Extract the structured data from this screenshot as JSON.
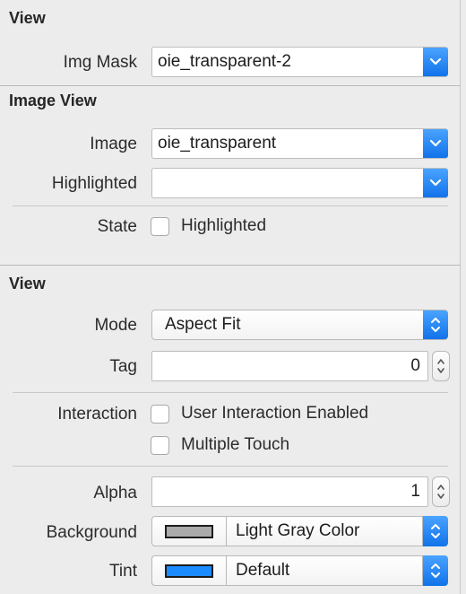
{
  "sections": {
    "view_mask": {
      "title": "View",
      "img_mask": {
        "label": "Img Mask",
        "value": "oie_transparent-2"
      }
    },
    "image_view": {
      "title": "Image View",
      "image": {
        "label": "Image",
        "value": "oie_transparent"
      },
      "highlighted": {
        "label": "Highlighted",
        "value": ""
      },
      "state": {
        "label": "State",
        "checkbox_label": "Highlighted",
        "checked": false
      }
    },
    "view": {
      "title": "View",
      "mode": {
        "label": "Mode",
        "value": "Aspect Fit"
      },
      "tag": {
        "label": "Tag",
        "value": "0"
      },
      "interaction": {
        "label": "Interaction",
        "user_interaction": {
          "label": "User Interaction Enabled",
          "checked": false
        },
        "multiple_touch": {
          "label": "Multiple Touch",
          "checked": false
        }
      },
      "alpha": {
        "label": "Alpha",
        "value": "1"
      },
      "background": {
        "label": "Background",
        "value": "Light Gray Color",
        "color": "#aaaaaa"
      },
      "tint": {
        "label": "Tint",
        "value": "Default",
        "color": "#1a8cff"
      }
    }
  },
  "colors": {
    "accent": "#1173ea",
    "panel_bg": "#ececec"
  }
}
